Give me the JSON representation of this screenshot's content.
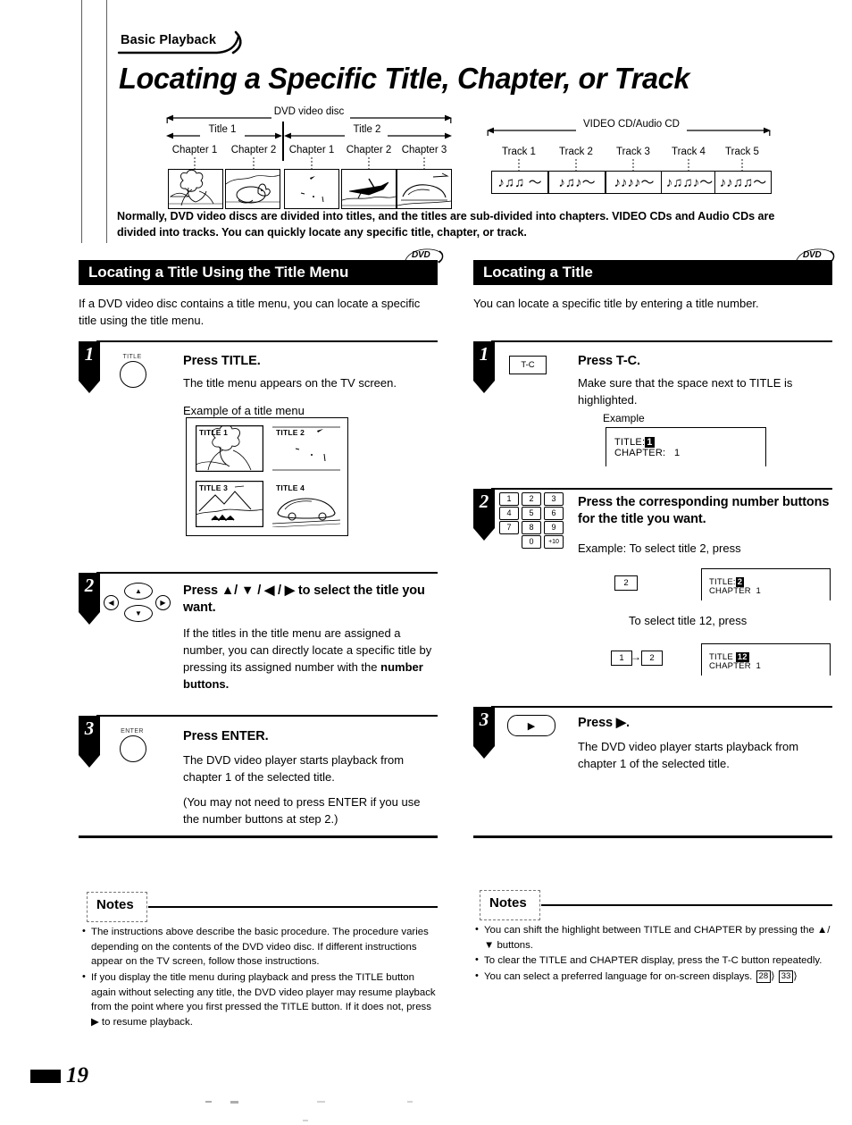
{
  "document": {
    "breadcrumb": "Basic Playback",
    "page_title": "Locating a Specific Title, Chapter, or Track",
    "page_number": "19"
  },
  "diagrams": {
    "dvd": {
      "span_label": "DVD video disc",
      "titles": [
        {
          "label": "Title 1",
          "chapters": [
            "Chapter 1",
            "Chapter 2"
          ]
        },
        {
          "label": "Title 2",
          "chapters": [
            "Chapter 1",
            "Chapter 2",
            "Chapter 3"
          ]
        }
      ]
    },
    "cd": {
      "span_label": "VIDEO CD/Audio CD",
      "tracks": [
        {
          "label": "Track 1",
          "notes": "♪♫♫ 〜"
        },
        {
          "label": "Track 2",
          "notes": "♪♫♪〜"
        },
        {
          "label": "Track 3",
          "notes": "♪♪♪♪〜"
        },
        {
          "label": "Track 4",
          "notes": "♪♫♫♪〜"
        },
        {
          "label": "Track 5",
          "notes": "♪♪♫♫〜"
        }
      ]
    }
  },
  "intro": "Normally, DVD video discs are divided into titles, and the titles are sub-divided into chapters. VIDEO CDs and Audio CDs are divided into tracks. You can quickly locate any specific title, chapter, or track.",
  "left_section": {
    "heading": "Locating a Title Using the Title Menu",
    "badge": "DVD",
    "lead": "If a DVD video disc contains a title menu, you can locate a specific title using the title menu.",
    "steps": [
      {
        "number": "1",
        "key_label": "TITLE",
        "title": "Press TITLE.",
        "body": "The title menu appears on the TV screen.",
        "example_caption": "Example of a title menu",
        "menu_cells": [
          "TITLE 1",
          "TITLE 2",
          "TITLE 3",
          "TITLE 4"
        ]
      },
      {
        "number": "2",
        "title": "Press ▲/ ▼ / ◀ / ▶  to select the title you want.",
        "body": "If the titles in the title menu are assigned a number, you can directly locate a specific title by pressing its assigned number with the",
        "body_bold_tail": "number buttons.",
        "keys": {
          "up": "▲",
          "down": "▼",
          "left": "◀",
          "right": "▶"
        }
      },
      {
        "number": "3",
        "key_label": "ENTER",
        "title": "Press ENTER.",
        "body": "The DVD video player starts playback from chapter 1 of the selected title.",
        "body2": "(You may not need to press ENTER if you use the number buttons at step 2.)"
      }
    ],
    "notes": {
      "label": "Notes",
      "items": [
        "The instructions above describe the basic procedure. The procedure varies depending on the contents of the DVD video disc. If different instructions appear on the TV screen, follow those instructions.",
        "If you display the title menu during playback and press the TITLE button again without selecting any title, the DVD video player may resume playback from the point where you first pressed the TITLE button. If it does not, press ▶ to resume playback."
      ]
    }
  },
  "right_section": {
    "heading": "Locating a Title",
    "badge": "DVD",
    "lead": "You can locate a specific title by entering a title number.",
    "steps": [
      {
        "number": "1",
        "key_label": "T-C",
        "title": "Press T-C.",
        "body": "Make sure that the space next to TITLE is highlighted.",
        "example_caption": "Example",
        "osd": {
          "title_label": "TITLE:",
          "title_value": "1",
          "chapter_label": "CHAPTER:",
          "chapter_value": "1"
        }
      },
      {
        "number": "2",
        "title": "Press the corresponding number buttons for the title you want.",
        "keypad": [
          "1",
          "2",
          "3",
          "4",
          "5",
          "6",
          "7",
          "8",
          "9",
          "0",
          "+10"
        ],
        "example_line_1": "Example: To select title 2, press",
        "press_1": [
          "2"
        ],
        "osd_1": {
          "title_label": "TITLE:",
          "title_value": "2",
          "chapter_label": "CHAPTER",
          "chapter_value": "1"
        },
        "example_line_2": "To select title 12, press",
        "press_2": [
          "1",
          "2"
        ],
        "osd_2": {
          "title_label": "TITLE",
          "title_value": "12",
          "chapter_label": "CHAPTER",
          "chapter_value": "1"
        }
      },
      {
        "number": "3",
        "key_label": "▶",
        "title": "Press ▶.",
        "body": "The DVD video player starts playback from chapter 1 of the selected title."
      }
    ],
    "notes": {
      "label": "Notes",
      "items": [
        "You can shift the highlight between TITLE and CHAPTER by pressing the ▲/▼ buttons.",
        "To clear the TITLE and CHAPTER display, press the T-C button repeatedly.",
        "You can select a preferred language for on-screen displays."
      ],
      "page_refs": [
        "28",
        "33"
      ]
    }
  },
  "colors": {
    "ink": "#000000",
    "paper": "#ffffff"
  }
}
